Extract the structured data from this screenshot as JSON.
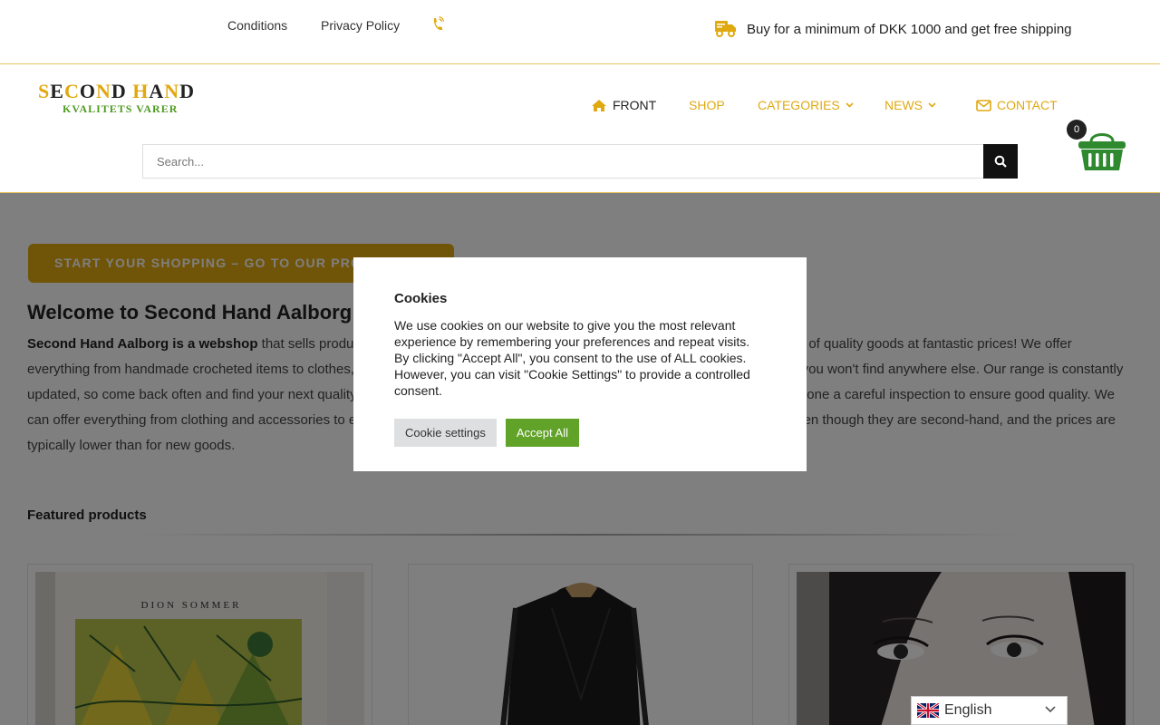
{
  "topbar": {
    "links": [
      "Conditions",
      "Privacy Policy"
    ],
    "phone_icon": "phone-icon",
    "shipping_text": "Buy for a minimum of DKK 1000 and get free shipping",
    "shipping_icon": "truck-icon"
  },
  "logo": {
    "line1": "SECOND HAND",
    "line2": "KVALITETS VARER",
    "colors": {
      "gold": "#e0a910",
      "green": "#4f9b22"
    }
  },
  "nav": {
    "front": "FRONT",
    "shop": "SHOP",
    "categories": "CATEGORIES",
    "news": "NEWS",
    "contact": "CONTACT"
  },
  "search": {
    "placeholder": "Search..."
  },
  "cart": {
    "count": "0"
  },
  "main": {
    "cta": "START YOUR SHOPPING – GO TO OUR PRODUCTS",
    "welcome_title": "Welcome to Second Hand Aalborg",
    "welcome_bold": "Second Hand Aalborg is a webshop",
    "welcome_text": " that sells products of second hand quality at low prices. Here you can find a wide selection of quality goods at fantastic prices! We offer everything from handmade crocheted items to clothes, books and much more. Make a good deal and discover exciting finds that you won't find anywhere else. Our range is constantly updated, so come back often and find your next quality purchase in our webshop! offers high-quality used goods that have undergone a careful inspection to ensure good quality. We can offer everything from clothing and accessories to electronics, furniture and other items. The products are in good condition even though they are second-hand, and the prices are typically lower than for new goods.",
    "featured_title": "Featured products"
  },
  "products": [
    {
      "image_text": "DION SOMMER"
    },
    {
      "image_text": ""
    },
    {
      "image_text": ""
    }
  ],
  "cookie": {
    "title": "Cookies",
    "text": "We use cookies on our website to give you the most relevant experience by remembering your preferences and repeat visits. By clicking \"Accept All\", you consent to the use of ALL cookies. However, you can visit \"Cookie Settings\" to provide a controlled consent.",
    "settings_label": "Cookie settings",
    "accept_label": "Accept All"
  },
  "language": {
    "code": "en",
    "label": "English"
  },
  "colors": {
    "accent": "#e0a910",
    "accept": "#61a229",
    "dark": "#111111"
  }
}
